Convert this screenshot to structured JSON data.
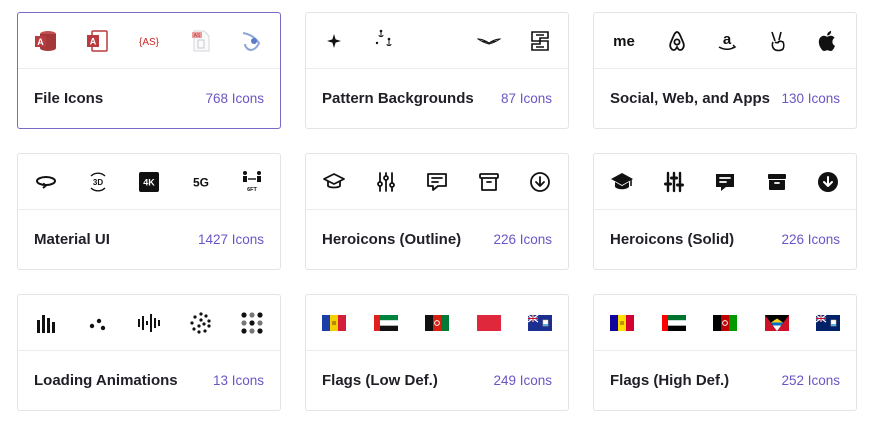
{
  "cards": [
    {
      "name": "File Icons",
      "count": "768 Icons",
      "icons": [
        "access-db-icon",
        "access-file-icon",
        "actionscript-icon",
        "as-file-icon",
        "angular-swoosh-icon"
      ]
    },
    {
      "name": "Pattern Backgrounds",
      "count": "87 Icons",
      "icons": [
        "sparkle-icon",
        "anchors-icon",
        "blank-icon",
        "wings-icon",
        "maze-icon"
      ]
    },
    {
      "name": "Social, Web, and Apps",
      "count": "130 Icons",
      "icons": [
        "me-icon",
        "airbnb-icon",
        "amazon-icon",
        "peace-hand-icon",
        "apple-icon"
      ]
    },
    {
      "name": "Material UI",
      "count": "1427 Icons",
      "icons": [
        "rotate-360-icon",
        "rotate-3d-icon",
        "4k-icon",
        "5g-icon",
        "6ft-apart-icon"
      ]
    },
    {
      "name": "Heroicons (Outline)",
      "count": "226 Icons",
      "icons": [
        "academic-cap-outline-icon",
        "adjustments-outline-icon",
        "annotation-outline-icon",
        "archive-outline-icon",
        "arrow-circle-down-outline-icon"
      ]
    },
    {
      "name": "Heroicons (Solid)",
      "count": "226 Icons",
      "icons": [
        "academic-cap-solid-icon",
        "adjustments-solid-icon",
        "annotation-solid-icon",
        "archive-solid-icon",
        "arrow-circle-down-solid-icon"
      ]
    },
    {
      "name": "Loading Animations",
      "count": "13 Icons",
      "icons": [
        "bars-loader-icon",
        "dots-loader-icon",
        "audio-loader-icon",
        "ball-triangle-loader-icon",
        "grid-loader-icon"
      ]
    },
    {
      "name": "Flags (Low Def.)",
      "count": "249 Icons",
      "icons": [
        "flag-andorra-icon",
        "flag-uae-icon",
        "flag-afghanistan-icon",
        "flag-albania-icon",
        "flag-anguilla-icon"
      ]
    },
    {
      "name": "Flags (High Def.)",
      "count": "252 Icons",
      "icons": [
        "flag-andorra-icon",
        "flag-uae-icon",
        "flag-afghanistan-icon",
        "flag-antigua-icon",
        "flag-anguilla-icon"
      ]
    }
  ],
  "glyphs": {
    "as_text": "{AS}",
    "me_text": "me",
    "k4_text": "4K",
    "g5_text": "5G",
    "d3_text": "3D",
    "ft_text": "6FT",
    "as_file_text": "AS"
  },
  "colors": {
    "accent": "#6b55c4",
    "active_border": "#7b68c9",
    "access_red": "#a4373a"
  }
}
